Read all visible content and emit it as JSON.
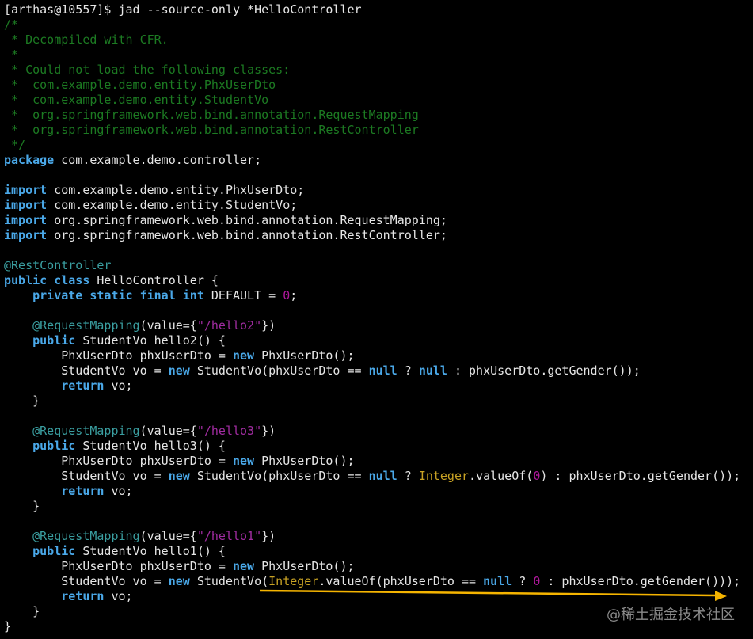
{
  "colors": {
    "keyword": "#4aa8e8",
    "comment": "#1c7a22",
    "annotation": "#3a9ea0",
    "string": "#a02ca0",
    "number": "#b0189c",
    "type": "#c8a224",
    "text": "#e6e6e6",
    "arrow": "#f5b400"
  },
  "lines": [
    [
      [
        "[arthas@10557]$ jad --source-only *HelloController",
        "t"
      ]
    ],
    [
      [
        "/*",
        "c"
      ]
    ],
    [
      [
        " * Decompiled with CFR.",
        "c"
      ]
    ],
    [
      [
        " *",
        "c"
      ]
    ],
    [
      [
        " * Could not load the following classes:",
        "c"
      ]
    ],
    [
      [
        " *  com.example.demo.entity.PhxUserDto",
        "c"
      ]
    ],
    [
      [
        " *  com.example.demo.entity.StudentVo",
        "c"
      ]
    ],
    [
      [
        " *  org.springframework.web.bind.annotation.RequestMapping",
        "c"
      ]
    ],
    [
      [
        " *  org.springframework.web.bind.annotation.RestController",
        "c"
      ]
    ],
    [
      [
        " */",
        "c"
      ]
    ],
    [
      [
        "package",
        "k"
      ],
      [
        " com.example.demo.controller;",
        "t"
      ]
    ],
    [],
    [
      [
        "import",
        "k"
      ],
      [
        " com.example.demo.entity.PhxUserDto;",
        "t"
      ]
    ],
    [
      [
        "import",
        "k"
      ],
      [
        " com.example.demo.entity.StudentVo;",
        "t"
      ]
    ],
    [
      [
        "import",
        "k"
      ],
      [
        " org.springframework.web.bind.annotation.RequestMapping;",
        "t"
      ]
    ],
    [
      [
        "import",
        "k"
      ],
      [
        " org.springframework.web.bind.annotation.RestController;",
        "t"
      ]
    ],
    [],
    [
      [
        "@RestController",
        "a"
      ]
    ],
    [
      [
        "public class",
        "k"
      ],
      [
        " HelloController {",
        "t"
      ]
    ],
    [
      [
        "    ",
        "t"
      ],
      [
        "private static final int",
        "k"
      ],
      [
        " DEFAULT = ",
        "t"
      ],
      [
        "0",
        "n"
      ],
      [
        ";",
        "t"
      ]
    ],
    [],
    [
      [
        "    ",
        "t"
      ],
      [
        "@RequestMapping",
        "a"
      ],
      [
        "(value={",
        "t"
      ],
      [
        "\"/hello2\"",
        "s"
      ],
      [
        "})",
        "t"
      ]
    ],
    [
      [
        "    ",
        "t"
      ],
      [
        "public",
        "k"
      ],
      [
        " StudentVo hello2() {",
        "t"
      ]
    ],
    [
      [
        "        PhxUserDto phxUserDto = ",
        "t"
      ],
      [
        "new",
        "k"
      ],
      [
        " PhxUserDto();",
        "t"
      ]
    ],
    [
      [
        "        StudentVo vo = ",
        "t"
      ],
      [
        "new",
        "k"
      ],
      [
        " StudentVo(phxUserDto == ",
        "t"
      ],
      [
        "null",
        "k"
      ],
      [
        " ? ",
        "t"
      ],
      [
        "null",
        "k"
      ],
      [
        " : phxUserDto.getGender());",
        "t"
      ]
    ],
    [
      [
        "        ",
        "t"
      ],
      [
        "return",
        "k"
      ],
      [
        " vo;",
        "t"
      ]
    ],
    [
      [
        "    }",
        "t"
      ]
    ],
    [],
    [
      [
        "    ",
        "t"
      ],
      [
        "@RequestMapping",
        "a"
      ],
      [
        "(value={",
        "t"
      ],
      [
        "\"/hello3\"",
        "s"
      ],
      [
        "})",
        "t"
      ]
    ],
    [
      [
        "    ",
        "t"
      ],
      [
        "public",
        "k"
      ],
      [
        " StudentVo hello3() {",
        "t"
      ]
    ],
    [
      [
        "        PhxUserDto phxUserDto = ",
        "t"
      ],
      [
        "new",
        "k"
      ],
      [
        " PhxUserDto();",
        "t"
      ]
    ],
    [
      [
        "        StudentVo vo = ",
        "t"
      ],
      [
        "new",
        "k"
      ],
      [
        " StudentVo(phxUserDto == ",
        "t"
      ],
      [
        "null",
        "k"
      ],
      [
        " ? ",
        "t"
      ],
      [
        "Integer",
        "y"
      ],
      [
        ".valueOf(",
        "t"
      ],
      [
        "0",
        "n"
      ],
      [
        ") : phxUserDto.getGender());",
        "t"
      ]
    ],
    [
      [
        "        ",
        "t"
      ],
      [
        "return",
        "k"
      ],
      [
        " vo;",
        "t"
      ]
    ],
    [
      [
        "    }",
        "t"
      ]
    ],
    [],
    [
      [
        "    ",
        "t"
      ],
      [
        "@RequestMapping",
        "a"
      ],
      [
        "(value={",
        "t"
      ],
      [
        "\"/hello1\"",
        "s"
      ],
      [
        "})",
        "t"
      ]
    ],
    [
      [
        "    ",
        "t"
      ],
      [
        "public",
        "k"
      ],
      [
        " StudentVo hello1() {",
        "t"
      ]
    ],
    [
      [
        "        PhxUserDto phxUserDto = ",
        "t"
      ],
      [
        "new",
        "k"
      ],
      [
        " PhxUserDto();",
        "t"
      ]
    ],
    [
      [
        "        StudentVo vo = ",
        "t"
      ],
      [
        "new",
        "k"
      ],
      [
        " StudentVo(",
        "t"
      ],
      [
        "Integer",
        "y"
      ],
      [
        ".valueOf(phxUserDto == ",
        "t"
      ],
      [
        "null",
        "k"
      ],
      [
        " ? ",
        "t"
      ],
      [
        "0",
        "n"
      ],
      [
        " : phxUserDto.getGender()));",
        "t"
      ]
    ],
    [
      [
        "        ",
        "t"
      ],
      [
        "return",
        "k"
      ],
      [
        " vo;",
        "t"
      ]
    ],
    [
      [
        "    }",
        "t"
      ]
    ],
    [
      [
        "}",
        "t"
      ]
    ]
  ],
  "watermark": "@稀土掘金技术社区"
}
